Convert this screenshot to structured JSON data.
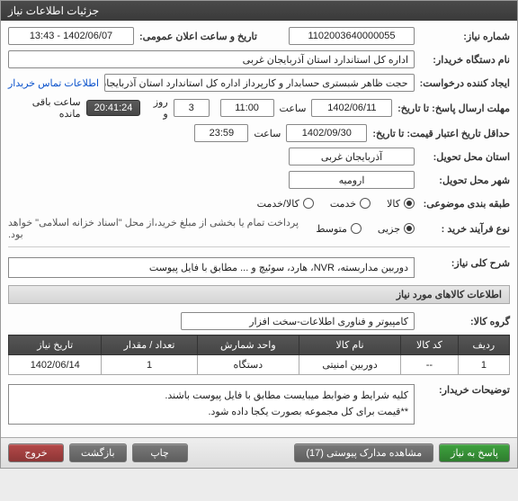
{
  "window": {
    "title": "جزئیات اطلاعات نیاز"
  },
  "form": {
    "need_no_label": "شماره نیاز:",
    "need_no": "1102003640000055",
    "announce_label": "تاریخ و ساعت اعلان عمومی:",
    "announce_value": "1402/06/07 - 13:43",
    "buyer_label": "نام دستگاه خریدار:",
    "buyer_value": "اداره کل استاندارد استان آذربایجان غربی",
    "requester_label": "ایجاد کننده درخواست:",
    "requester_value": "حجت ظاهر شبستری حسابدار و کارپرداز اداره کل استاندارد استان آذربایجان غربی",
    "contact_link": "اطلاعات تماس خریدار",
    "deadline_label": "مهلت ارسال پاسخ: تا تاریخ:",
    "deadline_date": "1402/06/11",
    "time_label": "ساعت",
    "deadline_time": "11:00",
    "day_label": "روز و",
    "days_left": "3",
    "countdown": "20:41:24",
    "remain_label": "ساعت باقی مانده",
    "validity_label": "حداقل تاریخ اعتبار قیمت: تا تاریخ:",
    "validity_date": "1402/09/30",
    "validity_time": "23:59",
    "province_label": "استان محل تحویل:",
    "province_value": "آذربایجان غربی",
    "city_label": "شهر محل تحویل:",
    "city_value": "ارومیه",
    "topic_class_label": "طبقه بندی موضوعی:",
    "topic_opts": {
      "a": "کالا",
      "b": "خدمت",
      "c": "کالا/خدمت"
    },
    "process_label": "نوع فرآیند خرید :",
    "process_opts": {
      "a": "جزیی",
      "b": "متوسط"
    },
    "process_note": "پرداخت تمام یا بخشی از مبلغ خرید،از محل \"اسناد خزانه اسلامی\" خواهد بود.",
    "desc_label": "شرح کلی نیاز:",
    "desc_value": "دوربین مداربسته، NVR، هارد، سوئیچ و ... مطابق با فایل پیوست",
    "items_header": "اطلاعات کالاهای مورد نیاز",
    "group_label": "گروه کالا:",
    "group_value": "کامپیوتر و فناوری اطلاعات-سخت افزار",
    "cols": {
      "row": "ردیف",
      "code": "کد کالا",
      "name": "نام کالا",
      "unit": "واحد شمارش",
      "qty": "تعداد / مقدار",
      "date": "تاریخ نیاز"
    },
    "rows": [
      {
        "row": "1",
        "code": "--",
        "name": "دوربین امنیتی",
        "unit": "دستگاه",
        "qty": "1",
        "date": "1402/06/14"
      }
    ],
    "buyer_notes_label": "توضیحات خریدار:",
    "buyer_notes": "کلیه شرایط و ضوابط میبایست مطابق با فایل پیوست باشند.\n**قیمت برای کل مجموعه بصورت یکجا داده شود."
  },
  "footer": {
    "respond": "پاسخ به نیاز",
    "attachments": "مشاهده مدارک پیوستی (17)",
    "print": "چاپ",
    "back": "بازگشت",
    "exit": "خروج"
  }
}
